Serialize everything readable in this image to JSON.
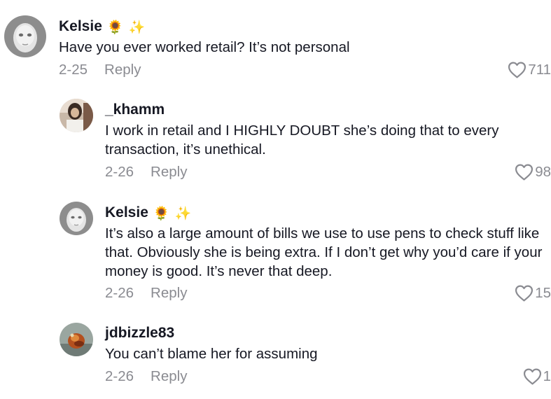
{
  "comments": [
    {
      "username": "Kelsie",
      "emojis": [
        "🌻",
        "✨"
      ],
      "text": "Have you ever worked retail? It’s not personal",
      "date": "2-25",
      "reply_label": "Reply",
      "likes": "711",
      "avatar": "mask-avatar"
    },
    {
      "username": "_khamm",
      "emojis": [],
      "text": "I work in retail and I HIGHLY DOUBT she’s doing that to every transaction, it’s unethical.",
      "date": "2-26",
      "reply_label": "Reply",
      "likes": "98",
      "avatar": "photo-avatar"
    },
    {
      "username": "Kelsie",
      "emojis": [
        "🌻",
        "✨"
      ],
      "text": "It’s also a large amount of bills we use to use pens to check stuff like that. Obviously she is being extra. If I don’t get why you’d care if your money is good. It’s never that deep.",
      "date": "2-26",
      "reply_label": "Reply",
      "likes": "15",
      "avatar": "mask-avatar"
    },
    {
      "username": "jdbizzle83",
      "emojis": [],
      "text": "You can’t blame her for assuming",
      "date": "2-26",
      "reply_label": "Reply",
      "likes": "1",
      "avatar": "photo-avatar"
    }
  ],
  "colors": {
    "text": "#161823",
    "muted": "#8a8b91",
    "background": "#ffffff"
  }
}
